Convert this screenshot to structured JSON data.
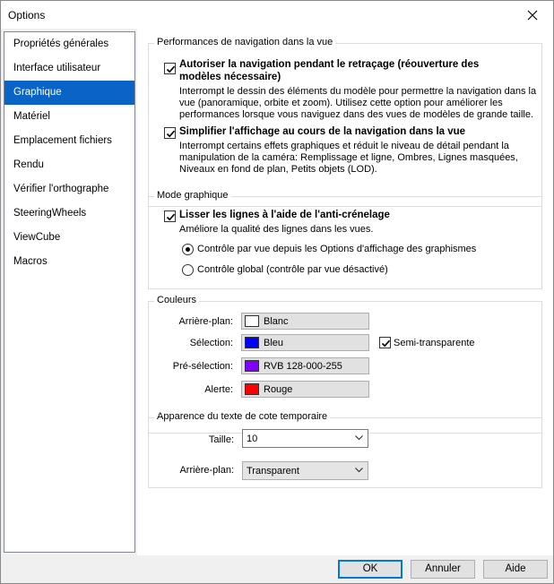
{
  "window": {
    "title": "Options"
  },
  "sidebar": {
    "items": [
      {
        "label": "Propriétés générales"
      },
      {
        "label": "Interface utilisateur"
      },
      {
        "label": "Graphique"
      },
      {
        "label": "Matériel"
      },
      {
        "label": "Emplacement fichiers"
      },
      {
        "label": "Rendu"
      },
      {
        "label": "Vérifier l'orthographe"
      },
      {
        "label": "SteeringWheels"
      },
      {
        "label": "ViewCube"
      },
      {
        "label": "Macros"
      }
    ],
    "selected": "Graphique"
  },
  "nav_perf": {
    "title": "Performances de navigation dans la vue",
    "opt1": {
      "checked": true,
      "label_l1": "Autoriser la navigation pendant le retraçage (réouverture des",
      "label_l2": "modèles nécessaire)",
      "desc_l1": "Interrompt le dessin des éléments du modèle pour permettre la navigation dans la",
      "desc_l2": "vue (panoramique, orbite et zoom). Utilisez cette option pour améliorer les",
      "desc_l3": "performances lorsque vous naviguez dans des vues de modèles de grande taille."
    },
    "opt2": {
      "checked": true,
      "label": "Simplifier l'affichage au cours de la navigation dans la vue",
      "desc_l1": "Interrompt certains effets graphiques et réduit le niveau de détail pendant la",
      "desc_l2": "manipulation de la caméra: Remplissage et ligne, Ombres, Lignes masquées,",
      "desc_l3": "Niveaux en fond de plan, Petits objets (LOD)."
    }
  },
  "graphic_mode": {
    "title": "Mode graphique",
    "antialias": {
      "checked": true,
      "label": "Lisser les lignes à l'aide de l'anti-crénelage",
      "desc": "Améliore la qualité des lignes dans les vues."
    },
    "radio1": {
      "label": "Contrôle par vue depuis les Options d'affichage des graphismes",
      "selected": true
    },
    "radio2": {
      "label": "Contrôle global (contrôle par vue désactivé)",
      "selected": false
    }
  },
  "colors": {
    "title": "Couleurs",
    "rows": [
      {
        "label": "Arrière-plan:",
        "value": "Blanc",
        "swatch": "#ffffff"
      },
      {
        "label": "Sélection:",
        "value": "Bleu",
        "swatch": "#0000ff"
      },
      {
        "label": "Pré-sélection:",
        "value": "RVB 128-000-255",
        "swatch": "#8000ff"
      },
      {
        "label": "Alerte:",
        "value": "Rouge",
        "swatch": "#ff0000"
      }
    ],
    "semi_transparent": {
      "checked": true,
      "label": "Semi-transparente"
    }
  },
  "temp_dim": {
    "title": "Apparence du texte de cote temporaire",
    "size": {
      "label": "Taille:",
      "value": "10"
    },
    "background": {
      "label": "Arrière-plan:",
      "value": "Transparent"
    }
  },
  "buttons": {
    "ok": "OK",
    "cancel": "Annuler",
    "help": "Aide"
  },
  "accent": "#0a64c8"
}
